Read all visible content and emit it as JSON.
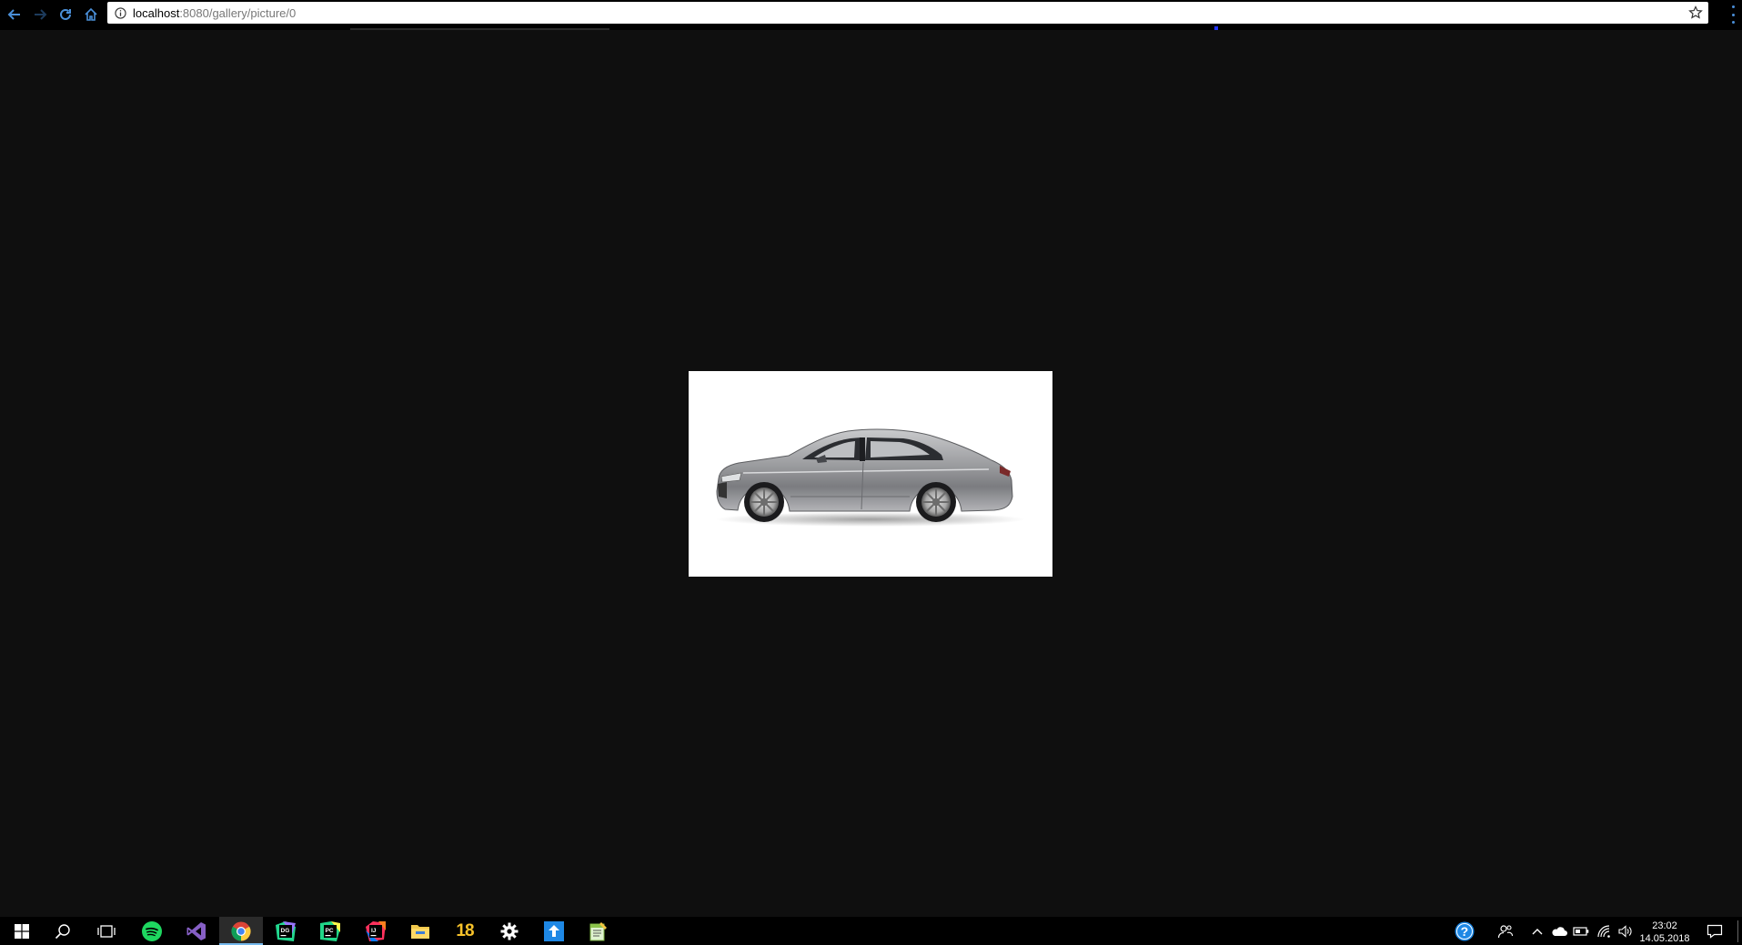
{
  "browser": {
    "url_host": "localhost",
    "url_path": ":8080/gallery/picture/0",
    "icons": {
      "back": "arrow-left-icon",
      "forward": "arrow-right-icon",
      "reload": "reload-icon",
      "home": "home-icon",
      "info": "info-icon",
      "bookmark": "star-icon",
      "menu": "menu-dots-icon"
    }
  },
  "page": {
    "picture_subject": "car"
  },
  "taskbar": {
    "apps": [
      "windows-start-icon",
      "search-icon",
      "task-view-icon",
      "spotify-icon",
      "visual-studio-icon",
      "chrome-icon",
      "datagrip-icon",
      "pycharm-icon",
      "intellij-icon",
      "file-explorer-icon",
      "calendar-18-icon",
      "settings-gear-icon",
      "upload-arrow-icon",
      "notepad-icon"
    ],
    "calendar_label": "18",
    "clock_time": "23:02",
    "clock_date": "14.05.2018"
  },
  "colors": {
    "accent": "#76b9ed",
    "background": "#0f0f0f",
    "nav_blue": "#4a8fd8"
  }
}
